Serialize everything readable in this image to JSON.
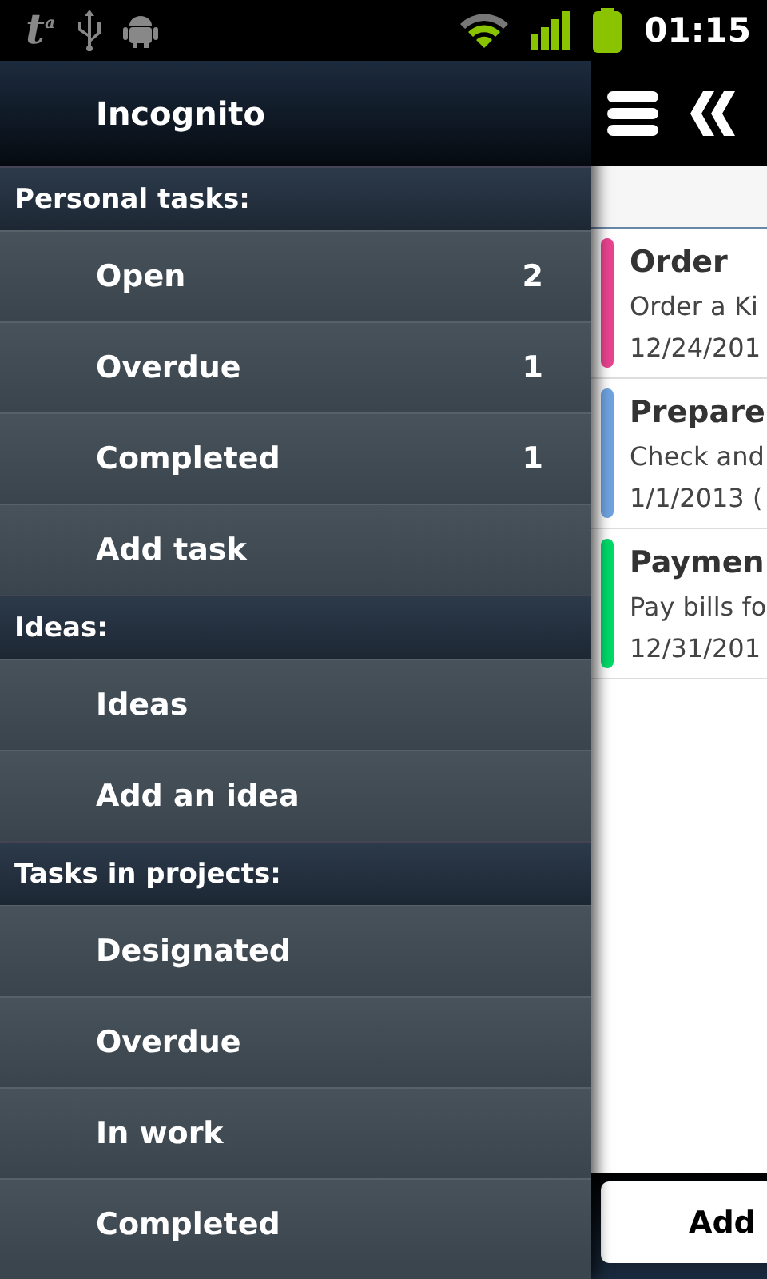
{
  "status_bar": {
    "app_glyph": "t$^{a}$",
    "time": "01:15"
  },
  "drawer": {
    "title": "Incognito",
    "sections": [
      {
        "title": "Personal tasks:",
        "items": [
          {
            "label": "Open",
            "count": "2"
          },
          {
            "label": "Overdue",
            "count": "1"
          },
          {
            "label": "Completed",
            "count": "1"
          },
          {
            "label": "Add task"
          }
        ]
      },
      {
        "title": "Ideas:",
        "items": [
          {
            "label": "Ideas"
          },
          {
            "label": "Add an idea"
          }
        ]
      },
      {
        "title": "Tasks in projects:",
        "items": [
          {
            "label": "Designated"
          },
          {
            "label": "Overdue"
          },
          {
            "label": "In work"
          },
          {
            "label": "Completed"
          }
        ]
      }
    ]
  },
  "task_list": {
    "tasks": [
      {
        "title": "Order",
        "description": "Order a Ki",
        "date": "12/24/201",
        "color": "#e8448f"
      },
      {
        "title": "Prepare",
        "description": "Check and",
        "date": "1/1/2013 (",
        "color": "#6fa3e0"
      },
      {
        "title": "Paymen",
        "description": "Pay bills fo",
        "date": "12/31/201",
        "color": "#00d96a"
      }
    ]
  },
  "add_button": "Add"
}
